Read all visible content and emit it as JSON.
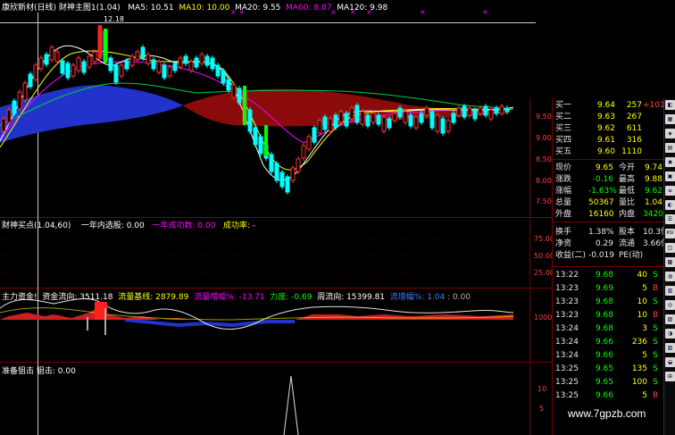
{
  "colors": {
    "up": "#ff3030",
    "down": "#00ffff",
    "ma5": "#ffffff",
    "ma10": "#ffff00",
    "ma20": "#ff00ff",
    "ma60": "#00ff00",
    "ma120": "#ffffff",
    "cloud_blue": "#2030c0",
    "cloud_red": "#8b0a0a",
    "frame": "#7a0000"
  },
  "main": {
    "title": "康欣新材(日线) 财神主图1(1.04)",
    "ma5": "MA5: 10.51",
    "ma10": "MA10: 10.00",
    "ma20": "MA20: 9.55",
    "ma60": "MA60: 8.87",
    "ma120": "MA120: 9.98",
    "high_label": "12.18",
    "y_ticks": [
      "9.50",
      "9.00",
      "8.50",
      "8.00",
      "7.50"
    ]
  },
  "ind1": {
    "title": "财神买点(1.04,60)",
    "label1": "一年内选股: 0.00",
    "label2": "一年成功数: 0.00",
    "label3": "成功率: -",
    "y_ticks": [
      "75.00",
      "50.00",
      "25.00"
    ]
  },
  "ind2": {
    "title": "主力资金!",
    "l1": "资金流向: 3511.18",
    "l2": "流量基线: 2879.89",
    "l3": "流量增幅%: -13.71",
    "l4": "力度: -0.69",
    "l5": "周流向: 15399.81",
    "l6": "流增幅%: 1.04",
    "l7": ": 0.00",
    "y_ticks": [
      "10000"
    ]
  },
  "ind3": {
    "title": "准备狙击 狙击: 0.00",
    "y_ticks": [
      "10",
      "5"
    ]
  },
  "panel": {
    "bids": [
      {
        "label": "买一",
        "price": "9.64",
        "vol": "257",
        "extra": "+101"
      },
      {
        "label": "买二",
        "price": "9.63",
        "vol": "267",
        "extra": ""
      },
      {
        "label": "买三",
        "price": "9.62",
        "vol": "611",
        "extra": ""
      },
      {
        "label": "买四",
        "price": "9.61",
        "vol": "316",
        "extra": ""
      },
      {
        "label": "买五",
        "price": "9.60",
        "vol": "1110",
        "extra": ""
      }
    ],
    "stats": [
      {
        "l1": "现价",
        "v1": "9.65",
        "l2": "今开",
        "v2": "9.74"
      },
      {
        "l1": "涨跌",
        "v1": "-0.16",
        "l2": "最高",
        "v2": "9.88"
      },
      {
        "l1": "涨幅",
        "v1": "-1.63%",
        "l2": "最低",
        "v2": "9.62"
      },
      {
        "l1": "总量",
        "v1": "50367",
        "l2": "量比",
        "v2": "1.04"
      },
      {
        "l1": "外盘",
        "v1": "16160",
        "l2": "内盘",
        "v2": "34207"
      }
    ],
    "stats2": [
      {
        "l1": "换手",
        "v1": "1.38%",
        "l2": "股本",
        "v2": "10.3亿"
      },
      {
        "l1": "净资",
        "v1": "0.29",
        "l2": "流通",
        "v2": "3.66亿"
      },
      {
        "l1": "收益(二)",
        "v1": "-0.019",
        "l2": "PE(动)",
        "v2": ""
      }
    ],
    "ticks": [
      {
        "time": "13:22",
        "price": "9.68",
        "vol": "40",
        "side": "S"
      },
      {
        "time": "13:23",
        "price": "9.69",
        "vol": "5",
        "side": "B"
      },
      {
        "time": "13:23",
        "price": "9.68",
        "vol": "10",
        "side": "S"
      },
      {
        "time": "13:23",
        "price": "9.68",
        "vol": "10",
        "side": "B"
      },
      {
        "time": "13:24",
        "price": "9.68",
        "vol": "3",
        "side": "S"
      },
      {
        "time": "13:24",
        "price": "9.66",
        "vol": "236",
        "side": "S"
      },
      {
        "time": "13:24",
        "price": "9.66",
        "vol": "5",
        "side": "S"
      },
      {
        "time": "13:25",
        "price": "9.65",
        "vol": "135",
        "side": "S"
      },
      {
        "time": "13:25",
        "price": "9.65",
        "vol": "100",
        "side": "S"
      },
      {
        "time": "13:25",
        "price": "9.66",
        "vol": "5",
        "side": "B"
      }
    ]
  },
  "toolbar": {
    "items": [
      "RSI"
    ]
  },
  "watermark": "www.7gpzb.com"
}
